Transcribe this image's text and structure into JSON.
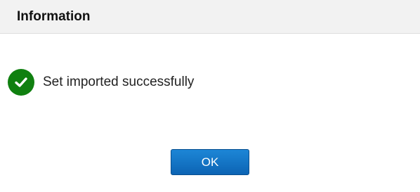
{
  "dialog": {
    "title": "Information",
    "message": "Set imported successfully",
    "status_icon": "check-circle-icon",
    "ok_label": "OK"
  },
  "colors": {
    "header_background": "#f2f2f2",
    "success_green": "#108010",
    "button_blue": "#0f6fc0"
  }
}
